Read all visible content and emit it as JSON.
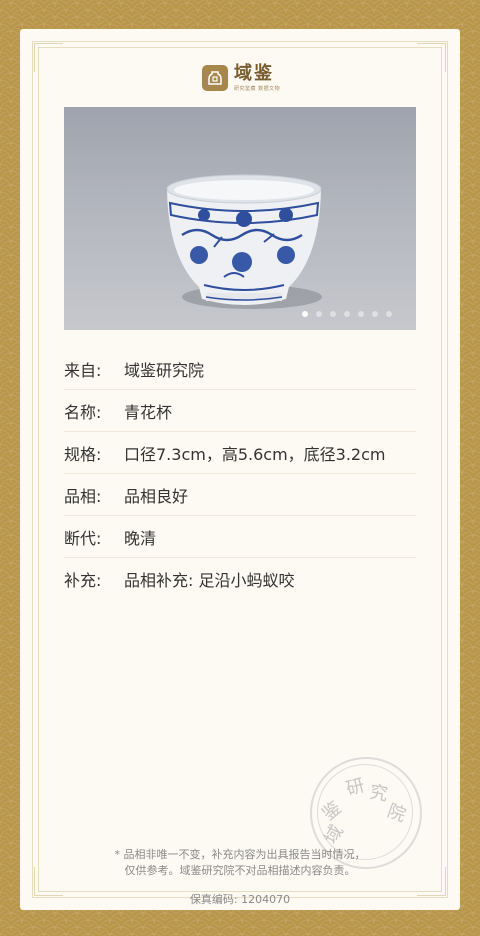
{
  "brand": {
    "name": "域鉴",
    "tagline": "研究鉴藏 数据文物"
  },
  "photo": {
    "alt": "青花杯",
    "slides_total": 7,
    "active_slide": 1
  },
  "details": [
    {
      "label": "来自:",
      "value": "域鉴研究院"
    },
    {
      "label": "名称:",
      "value": "青花杯"
    },
    {
      "label": "规格:",
      "value": "口径7.3cm，高5.6cm，底径3.2cm"
    },
    {
      "label": "品相:",
      "value": "品相良好"
    },
    {
      "label": "断代:",
      "value": "晚清"
    },
    {
      "label": "补充:",
      "value": "品相补充:  足沿小蚂蚁咬"
    }
  ],
  "seal": {
    "chars": [
      "研",
      "究",
      "院",
      "鉴",
      "域"
    ]
  },
  "footer": {
    "note_line1": "* 品相非唯一不变，补充内容为出具报告当时情况，",
    "note_line2": "仅供参考。域鉴研究院不对品相描述内容负责。",
    "code_label": "保真编码:",
    "code_value": "1204070"
  }
}
